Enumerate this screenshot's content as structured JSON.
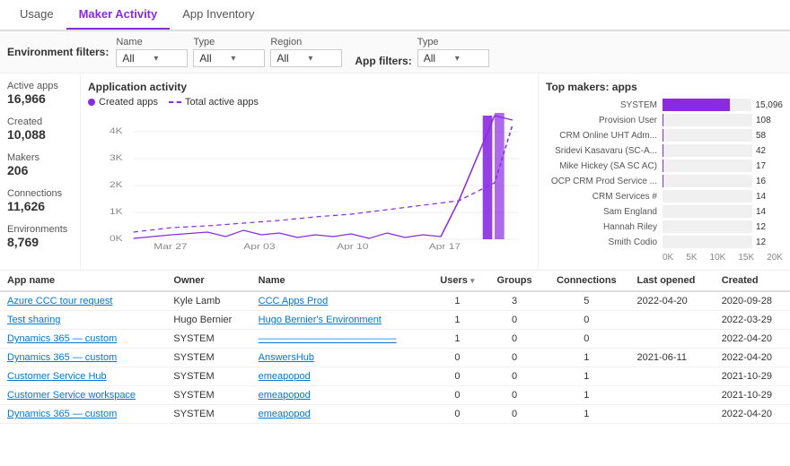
{
  "tabs": [
    {
      "label": "Usage",
      "active": false
    },
    {
      "label": "Maker Activity",
      "active": true
    },
    {
      "label": "App Inventory",
      "active": false
    }
  ],
  "filters": {
    "env_label": "Environment filters:",
    "app_label": "App filters:",
    "name": {
      "label": "Name",
      "value": "All"
    },
    "type": {
      "label": "Type",
      "value": "All"
    },
    "region": {
      "label": "Region",
      "value": "All"
    },
    "app_type": {
      "label": "Type",
      "value": "All"
    }
  },
  "stats": [
    {
      "label": "Active apps",
      "value": "16,966"
    },
    {
      "label": "Created",
      "value": "10,088"
    },
    {
      "label": "Makers",
      "value": "206"
    },
    {
      "label": "Connections",
      "value": "11,626"
    },
    {
      "label": "Environments",
      "value": "8,769"
    }
  ],
  "chart": {
    "title": "Application activity",
    "legend": [
      {
        "type": "dot",
        "label": "Created apps"
      },
      {
        "type": "dash",
        "label": "Total active apps"
      }
    ],
    "x_labels": [
      "Mar 27",
      "Apr 03",
      "Apr 10",
      "Apr 17"
    ],
    "y_labels": [
      "0K",
      "1K",
      "2K",
      "3K",
      "4K"
    ]
  },
  "top_makers": {
    "title": "Top makers: apps",
    "x_labels": [
      "0K",
      "5K",
      "10K",
      "15K",
      "20K"
    ],
    "bars": [
      {
        "name": "SYSTEM",
        "value": 15096,
        "display": "15,096"
      },
      {
        "name": "Provision User",
        "value": 108,
        "display": "108"
      },
      {
        "name": "CRM Online UHT Adm...",
        "value": 58,
        "display": "58"
      },
      {
        "name": "Sridevi Kasavaru (SC-A...",
        "value": 42,
        "display": "42"
      },
      {
        "name": "Mike Hickey (SA SC AC)",
        "value": 17,
        "display": "17"
      },
      {
        "name": "OCP CRM Prod Service ...",
        "value": 16,
        "display": "16"
      },
      {
        "name": "CRM Services #",
        "value": 14,
        "display": "14"
      },
      {
        "name": "Sam England",
        "value": 14,
        "display": "14"
      },
      {
        "name": "Hannah Riley",
        "value": 12,
        "display": "12"
      },
      {
        "name": "Smith Codio",
        "value": 12,
        "display": "12"
      }
    ],
    "max": 20000
  },
  "table": {
    "columns": [
      "App name",
      "Owner",
      "Name",
      "Users",
      "Groups",
      "Connections",
      "Last opened",
      "Created"
    ],
    "rows": [
      {
        "app_name": "Azure CCC tour request",
        "owner": "Kyle Lamb",
        "name": "CCC Apps Prod",
        "users": "1",
        "groups": "3",
        "connections": "5",
        "last_opened": "2022-04-20",
        "created": "2020-09-28"
      },
      {
        "app_name": "Test sharing",
        "owner": "Hugo Bernier",
        "name": "Hugo Bernier's Environment",
        "users": "1",
        "groups": "0",
        "connections": "0",
        "last_opened": "",
        "created": "2022-03-29"
      },
      {
        "app_name": "Dynamics 365 — custom",
        "owner": "SYSTEM",
        "name": "——————————————",
        "users": "1",
        "groups": "0",
        "connections": "0",
        "last_opened": "",
        "created": "2022-04-20"
      },
      {
        "app_name": "Dynamics 365 — custom",
        "owner": "SYSTEM",
        "name": "AnswersHub",
        "users": "0",
        "groups": "0",
        "connections": "1",
        "last_opened": "2021-06-11",
        "created": "2022-04-20"
      },
      {
        "app_name": "Customer Service Hub",
        "owner": "SYSTEM",
        "name": "emeapopod",
        "users": "0",
        "groups": "0",
        "connections": "1",
        "last_opened": "",
        "created": "2021-10-29"
      },
      {
        "app_name": "Customer Service workspace",
        "owner": "SYSTEM",
        "name": "emeapopod",
        "users": "0",
        "groups": "0",
        "connections": "1",
        "last_opened": "",
        "created": "2021-10-29"
      },
      {
        "app_name": "Dynamics 365 — custom",
        "owner": "SYSTEM",
        "name": "emeapopod",
        "users": "0",
        "groups": "0",
        "connections": "1",
        "last_opened": "",
        "created": "2022-04-20"
      }
    ]
  }
}
